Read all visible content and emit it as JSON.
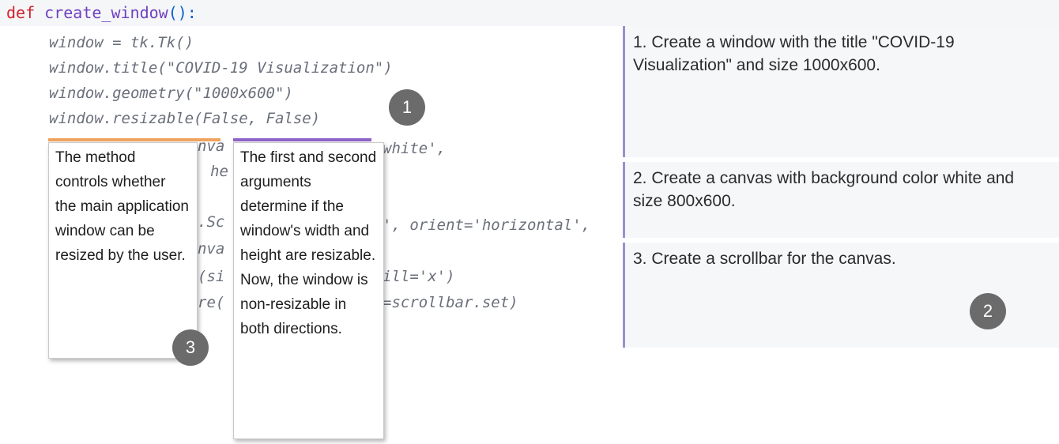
{
  "code": {
    "def_keyword": "def",
    "function_name": "create_window",
    "signature_tail": "():",
    "lines": [
      "window = tk.Tk()",
      "window.title(\"COVID-19 Visualization\")",
      "window.geometry(\"1000x600\")",
      "window.resizable(False, False)"
    ],
    "fragments": {
      "f1": "nva",
      "f2": "white',",
      "f3": "he",
      "f4": ".Sc",
      "f5": "', orient='horizontal',",
      "f6": "nva",
      "f7": "(si",
      "f8": "ill='x')",
      "f9": "re(",
      "f10": "=scrollbar.set)"
    }
  },
  "explanations": [
    "1. Create a window with the title \"COVID-19 Visualization\" and size 1000x600.",
    "2. Create a canvas with background color white and size 800x600.",
    "3. Create a scrollbar for the canvas."
  ],
  "tooltips": {
    "method": "The method controls whether the main application window can be resized by the user.",
    "args": "The first and second arguments determine if the window's width and height are resizable. Now, the window is non-resizable in both directions."
  },
  "badges": [
    "1",
    "2",
    "3"
  ],
  "colors": {
    "keyword": "#cf222e",
    "function": "#6f42c1",
    "marker_method": "#f0a35e",
    "marker_args": "#8e63c9",
    "explanation_border": "#9d8fcf",
    "badge": "#6b6b6b"
  }
}
